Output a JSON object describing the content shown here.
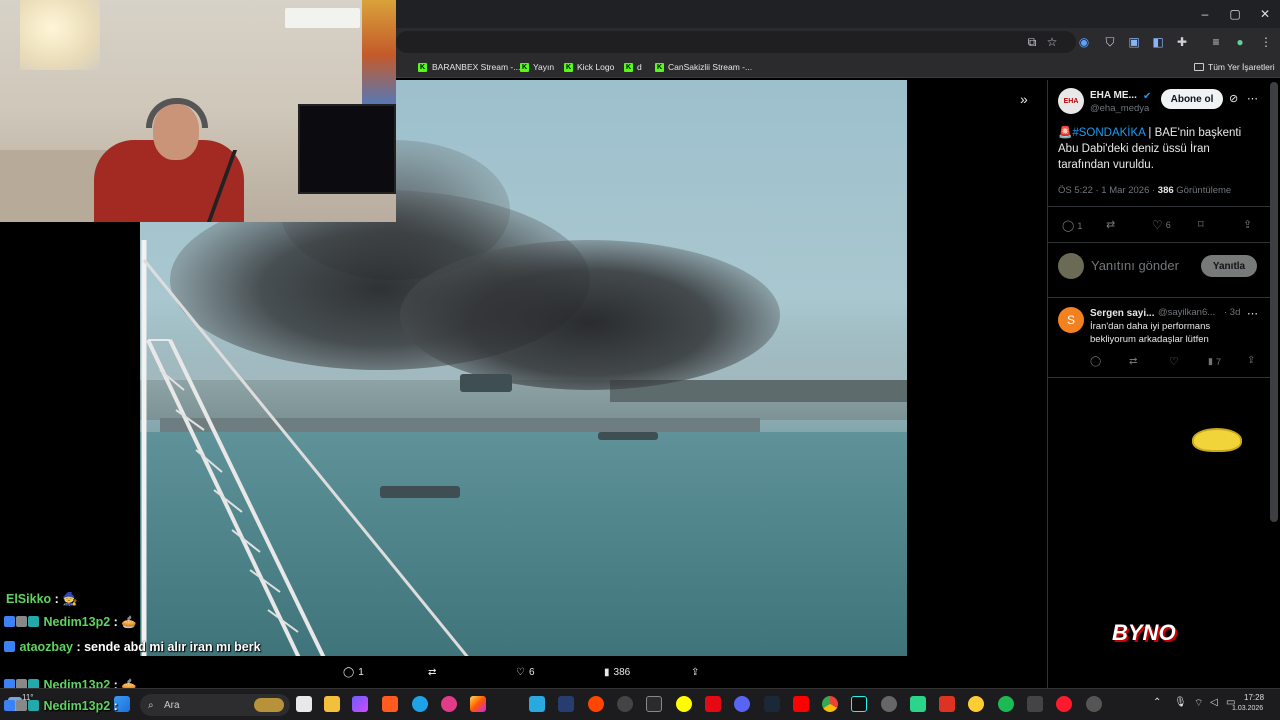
{
  "browser": {
    "window_controls": [
      "–",
      "▢",
      "✕"
    ],
    "bookmarks": [
      {
        "label": "BARANBEX Stream -..."
      },
      {
        "label": "Yayın"
      },
      {
        "label": "Kick Logo"
      },
      {
        "label": "d"
      },
      {
        "label": "CanSakizlii Stream -..."
      }
    ],
    "all_bookmarks": "Tüm Yer İşaretleri"
  },
  "media_bar": {
    "replies": "1",
    "likes": "6",
    "views": "386"
  },
  "tweet": {
    "author_name": "EHA ME...",
    "author_handle": "@eha_medya",
    "follow_label": "Abone ol",
    "text_hashtag": "#SONDAKİKA",
    "text_body": " | BAE'nin başkenti Abu Dabi'deki deniz üssü İran tarafından vuruldu.",
    "timestamp": "ÖS 5:22 · 1 Mar 2026 · ",
    "views_count": "386",
    "views_label": " Görüntüleme",
    "replies": "1",
    "likes": "6",
    "reply_placeholder": "Yanıtını gönder",
    "reply_button": "Yanıtla"
  },
  "reply": {
    "author_name": "Sergen sayi...",
    "author_handle": "@sayilkan6...",
    "age": "· 3d",
    "text": "İran'dan daha iyi performans bekliyorum arkadaşlar lütfen",
    "views": "7"
  },
  "chat": [
    {
      "user": "ElSikko",
      "text": "",
      "color": "#5fd35f"
    },
    {
      "user": "Nedim13p2",
      "text": "",
      "color": "#5fd35f"
    },
    {
      "user": "ataozbay",
      "text": "sende abd mi alır iran mı berk",
      "color": "#5fd35f"
    },
    {
      "user": "Nedim13p2",
      "text": "",
      "color": "#5fd35f"
    },
    {
      "user": "Nedim13p2",
      "text": "",
      "color": "#5fd35f"
    }
  ],
  "taskbar": {
    "search_label": "Ara",
    "time": "17:28",
    "date": "1.03.2026",
    "weather": "11°"
  },
  "overlay_logo": "BYNO"
}
